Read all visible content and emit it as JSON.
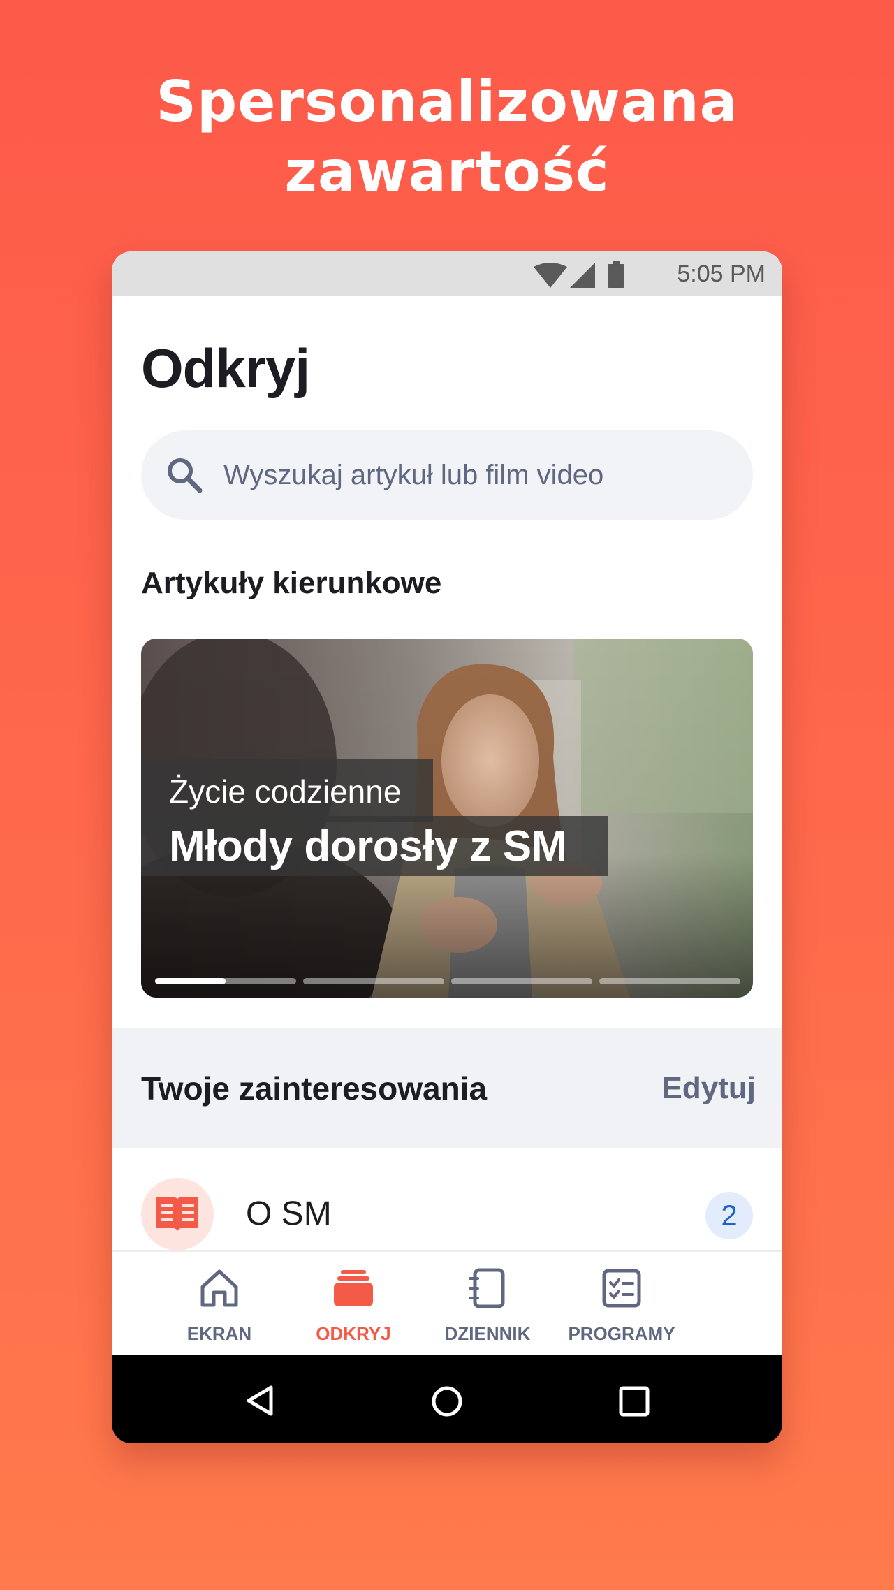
{
  "promo": {
    "line1": "Spersonalizowana",
    "line2": "zawartość"
  },
  "status_bar": {
    "time": "5:05 PM",
    "icons": [
      "wifi-icon",
      "signal-icon",
      "battery-icon"
    ]
  },
  "discover": {
    "title": "Odkryj",
    "search": {
      "placeholder": "Wyszukaj artykuł lub film video",
      "icon": "search-icon"
    },
    "featured_title": "Artykuły kierunkowe",
    "featured_card": {
      "category": "Życie codzienne",
      "title": "Młody dorosły z SM",
      "slides_total": 4,
      "active_slide": 1,
      "active_progress": 0.5
    },
    "interests": {
      "title": "Twoje zainteresowania",
      "edit_label": "Edytuj",
      "items": [
        {
          "label": "O SM",
          "count": "2",
          "icon": "book-icon"
        }
      ]
    }
  },
  "bottom_nav": {
    "items": [
      {
        "label": "EKRAN",
        "icon": "home-icon",
        "active": false
      },
      {
        "label": "ODKRYJ",
        "icon": "stack-icon",
        "active": true
      },
      {
        "label": "DZIENNIK",
        "icon": "notebook-icon",
        "active": false
      },
      {
        "label": "PROGRAMY",
        "icon": "checklist-icon",
        "active": false
      }
    ]
  },
  "colors": {
    "background": "#fd5a4a",
    "accent": "#f35a48",
    "muted": "#5f6880",
    "badge_text": "#1e64c8"
  }
}
